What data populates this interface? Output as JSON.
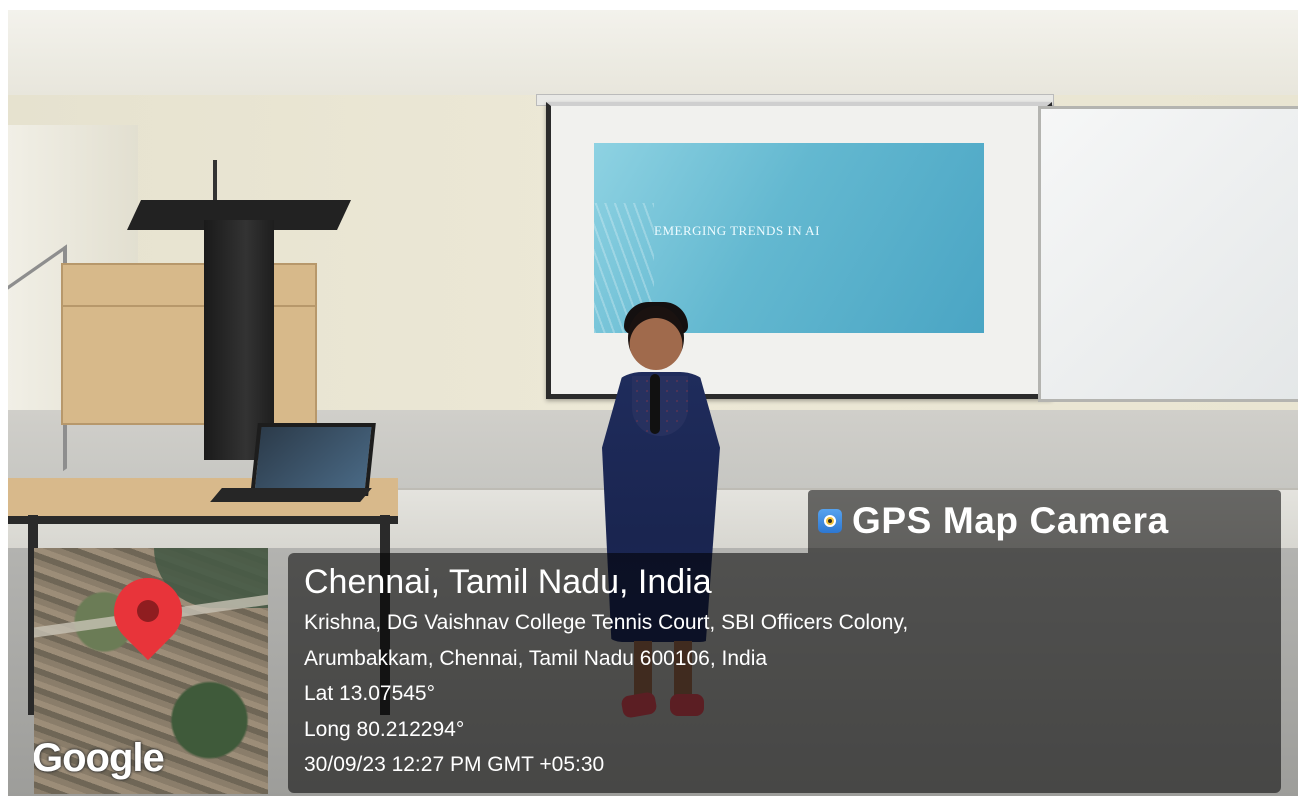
{
  "slide": {
    "title": "EMERGING TRENDS IN AI",
    "subtitle_lines": [
      "",
      "",
      ""
    ]
  },
  "gps": {
    "app_name": "GPS Map Camera",
    "app_icon": "camera-lens-icon",
    "location_title": "Chennai, Tamil Nadu, India",
    "address_line1": "Krishna, DG Vaishnav College Tennis Court, SBI Officers Colony,",
    "address_line2": "Arumbakkam, Chennai, Tamil Nadu 600106, India",
    "latitude": "Lat 13.07545°",
    "longitude": "Long 80.212294°",
    "timestamp": "30/09/23 12:27 PM GMT +05:30"
  },
  "map": {
    "attribution": "Google",
    "marker_icon": "map-pin-icon",
    "marker_color": "#e8343a"
  }
}
